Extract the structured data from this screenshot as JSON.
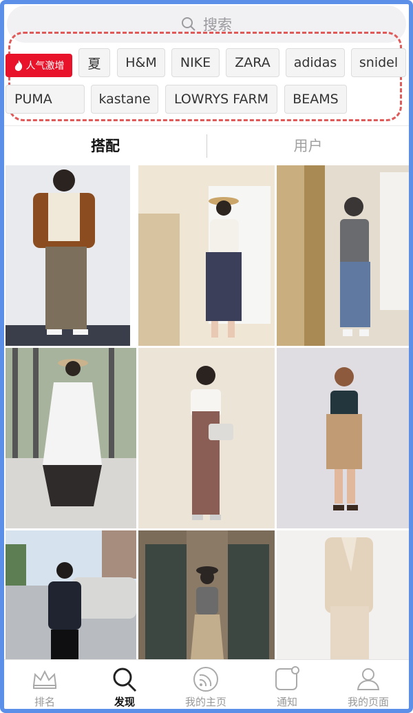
{
  "search": {
    "label": "搜索"
  },
  "hot_badge": {
    "label": "人气激增",
    "color": "#e8132a"
  },
  "brands": [
    "夏",
    "H&M",
    "NIKE",
    "ZARA",
    "adidas",
    "snidel",
    "PUMA",
    "kastane",
    "LOWRYS FARM",
    "BEAMS"
  ],
  "tabs": [
    {
      "label": "搭配",
      "active": true
    },
    {
      "label": "用户",
      "active": false
    }
  ],
  "bottom_nav": [
    {
      "label": "排名",
      "icon": "crown-icon"
    },
    {
      "label": "发现",
      "icon": "search-icon",
      "active": true
    },
    {
      "label": "我的主页",
      "icon": "feed-icon"
    },
    {
      "label": "通知",
      "icon": "notification-icon"
    },
    {
      "label": "我的页面",
      "icon": "profile-icon"
    }
  ],
  "colors": {
    "accent": "#e8132a",
    "frame": "#5b8fe8",
    "dashed": "#e05a5a"
  }
}
